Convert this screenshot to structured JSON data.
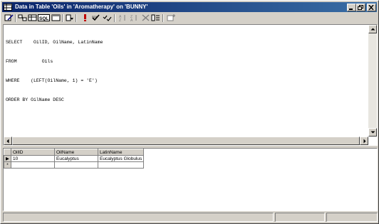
{
  "window": {
    "title": "Data in Table 'Oils' in 'Aromatherapy' on 'BUNNY'"
  },
  "toolbar": {
    "icons": [
      "design-icon",
      "sql-pane-icon",
      "diagram-pane-icon",
      "sql-label-icon",
      "results-pane-icon",
      "change-type-icon",
      "run-icon",
      "verify-sql-icon",
      "sort-ascending-icon",
      "sort-descending-icon",
      "remove-filter-icon",
      "group-by-icon",
      "add-table-icon"
    ],
    "sql_button_label": "SQL"
  },
  "sql": {
    "lines": [
      "SELECT    OilID, OilName, LatinName",
      "FROM         Oils",
      "WHERE    (LEFT(OilName, 1) = 'E')",
      "ORDER BY OilName DESC"
    ]
  },
  "grid": {
    "columns": [
      "OilID",
      "OilName",
      "LatinName"
    ],
    "rows": [
      {
        "indicator": "▶",
        "cells": [
          "10",
          "Eucalyptus",
          "Eucalyptus Globulus"
        ]
      },
      {
        "indicator": "*",
        "cells": [
          "",
          "",
          ""
        ]
      }
    ]
  },
  "colors": {
    "title_start": "#0a246a",
    "title_end": "#3a6ea5",
    "chrome": "#d4d0c8"
  }
}
